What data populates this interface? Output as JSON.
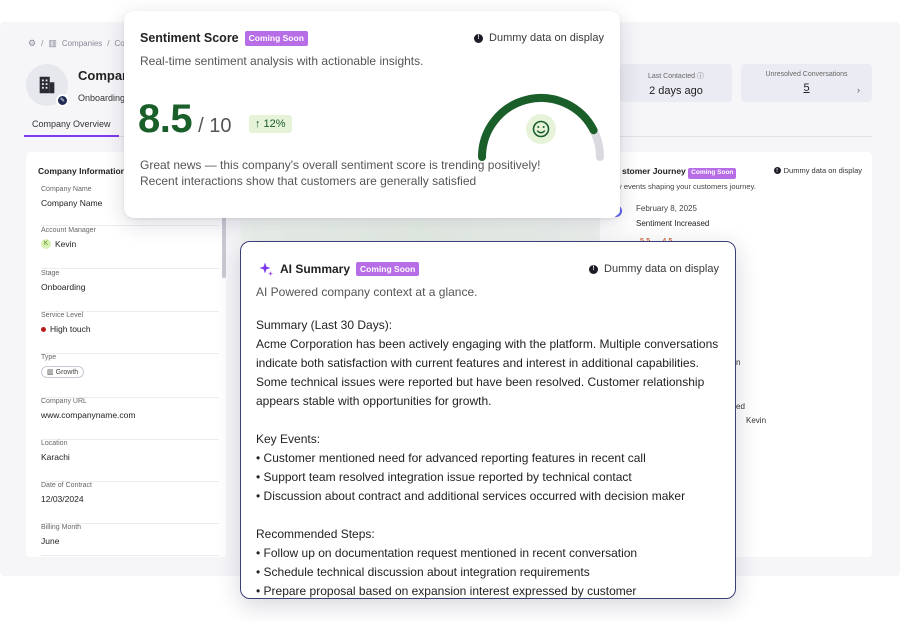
{
  "breadcrumb": {
    "companies": "Companies",
    "current": "Co"
  },
  "company": {
    "name": "Compan",
    "stage": "Onboarding"
  },
  "tabs": {
    "overview": "Company Overview"
  },
  "metrics": {
    "last_contacted_label": "Last Contacted",
    "last_contacted_value": "2 days ago",
    "unresolved_label": "Unresolved Conversations",
    "unresolved_value": "5"
  },
  "info_panel": {
    "title": "Company Information",
    "fields": [
      {
        "label": "Company Name",
        "value": "Company Name"
      },
      {
        "label": "Account Manager",
        "value": "Kevin",
        "avatar": "K"
      },
      {
        "label": "Stage",
        "value": "Onboarding"
      },
      {
        "label": "Service Level",
        "value": "High touch"
      },
      {
        "label": "Type",
        "value": "Growth"
      },
      {
        "label": "Company URL",
        "value": "www.companyname.com"
      },
      {
        "label": "Location",
        "value": "Karachi"
      },
      {
        "label": "Date of Contract",
        "value": "12/03/2024"
      },
      {
        "label": "Billing Month",
        "value": "June"
      }
    ]
  },
  "journey": {
    "title": "stomer Journey",
    "badge": "Coming Soon",
    "dummy": "Dummy data on display",
    "subtitle": "y events shaping your customers journey.",
    "event_date": "February 8, 2025",
    "event_title": "Sentiment Increased",
    "event_change": "5.5 → 4.5",
    "partial_1": "n",
    "partial_2": "ed",
    "partial_kevin": "Kevin"
  },
  "sentiment": {
    "title": "Sentiment Score",
    "badge": "Coming Soon",
    "dummy": "Dummy data on display",
    "description": "Real-time sentiment analysis with actionable insights.",
    "score": "8.5",
    "out_of": "/ 10",
    "trend": "↑ 12%",
    "gauge_fraction": 0.85,
    "summary_line1": "Great news — this company's overall sentiment score is trending positively!",
    "summary_line2": "Recent interactions show that customers are generally satisfied"
  },
  "ai_summary": {
    "title": "AI Summary",
    "badge": "Coming Soon",
    "dummy": "Dummy data on display",
    "description": "AI Powered company context at a glance.",
    "summary_heading": "Summary (Last 30 Days):",
    "summary_text": "Acme Corporation has been actively engaging with the platform. Multiple conversations indicate both satisfaction with current features and interest in additional capabilities. Some technical issues were reported but have been resolved. Customer relationship appears stable with opportunities for growth.",
    "events_heading": "Key Events:",
    "events": [
      "• Customer mentioned need for advanced reporting features in recent call",
      "• Support team resolved integration issue reported by technical contact",
      "• Discussion about contract and additional services occurred with decision maker"
    ],
    "steps_heading": "Recommended Steps:",
    "steps": [
      "• Follow up on documentation request mentioned in recent conversation",
      "• Schedule technical discussion about integration requirements",
      "• Prepare proposal based on expansion interest expressed by customer"
    ]
  },
  "colors": {
    "accent": "#7c3aed",
    "badge": "#b66de6",
    "score_green": "#1a5e2a",
    "gauge_track": "#d9d9df",
    "ai_border": "#3c3f77"
  }
}
